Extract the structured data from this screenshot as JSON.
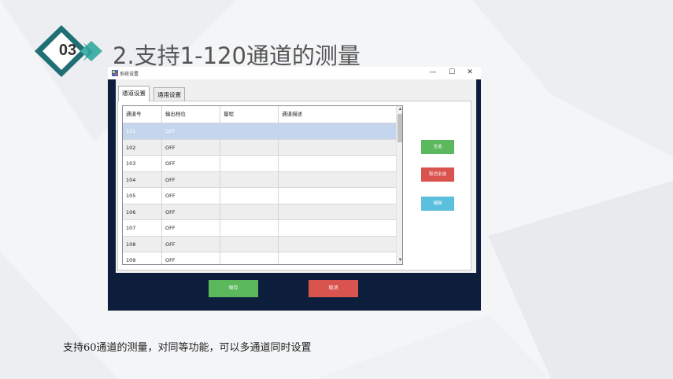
{
  "slide": {
    "section_number": "03",
    "title": "2.支持1-120通道的测量",
    "caption": "支持60通道的测量，对同等功能，可以多通道同时设置"
  },
  "window": {
    "title": "系统设置",
    "minimize": "—",
    "maximize": "☐",
    "close": "✕"
  },
  "tabs": [
    {
      "label": "通道设置",
      "active": true
    },
    {
      "label": "通用设置",
      "active": false
    }
  ],
  "table": {
    "columns": [
      "通道号",
      "输出档位",
      "量程",
      "通道描述"
    ],
    "rows": [
      {
        "channel": "101",
        "output": "OFF",
        "range": "",
        "desc": "",
        "selected": true
      },
      {
        "channel": "102",
        "output": "OFF",
        "range": "",
        "desc": ""
      },
      {
        "channel": "103",
        "output": "OFF",
        "range": "",
        "desc": ""
      },
      {
        "channel": "104",
        "output": "OFF",
        "range": "",
        "desc": ""
      },
      {
        "channel": "105",
        "output": "OFF",
        "range": "",
        "desc": ""
      },
      {
        "channel": "106",
        "output": "OFF",
        "range": "",
        "desc": ""
      },
      {
        "channel": "107",
        "output": "OFF",
        "range": "",
        "desc": ""
      },
      {
        "channel": "108",
        "output": "OFF",
        "range": "",
        "desc": ""
      },
      {
        "channel": "109",
        "output": "OFF",
        "range": "",
        "desc": ""
      }
    ]
  },
  "side_buttons": {
    "select_all": "全选",
    "deselect_all": "取消全选",
    "edit": "编辑"
  },
  "bottom_buttons": {
    "save": "保存",
    "cancel": "取消"
  },
  "colors": {
    "accent_teal": "#2a9a93",
    "dark_panel": "#0d1e3d",
    "green_button": "#5cb85c",
    "red_button": "#d9534f",
    "blue_button": "#5bc0de",
    "selected_row": "#c4d5ee"
  }
}
